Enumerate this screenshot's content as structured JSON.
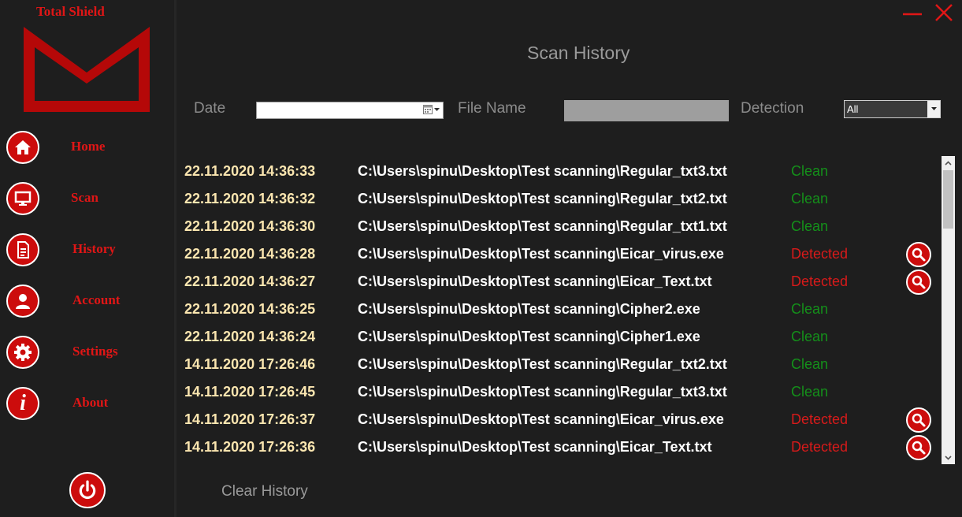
{
  "app": {
    "title": "Total Shield"
  },
  "nav": [
    {
      "label": "Home",
      "icon": "home-icon"
    },
    {
      "label": "Scan",
      "icon": "monitor-icon"
    },
    {
      "label": "History",
      "icon": "document-icon"
    },
    {
      "label": "Account",
      "icon": "user-icon"
    },
    {
      "label": "Settings",
      "icon": "gear-icon"
    },
    {
      "label": "About",
      "icon": "info-icon"
    }
  ],
  "page": {
    "title": "Scan History"
  },
  "filters": {
    "date_label": "Date",
    "date_value": "",
    "filename_label": "File Name",
    "filename_value": "",
    "detection_label": "Detection",
    "detection_value": "All"
  },
  "history": [
    {
      "date": "22.11.2020 14:36:33",
      "path": "C:\\Users\\spinu\\Desktop\\Test scanning\\Regular_txt3.txt",
      "status": "Clean"
    },
    {
      "date": "22.11.2020 14:36:32",
      "path": "C:\\Users\\spinu\\Desktop\\Test scanning\\Regular_txt2.txt",
      "status": "Clean"
    },
    {
      "date": "22.11.2020 14:36:30",
      "path": "C:\\Users\\spinu\\Desktop\\Test scanning\\Regular_txt1.txt",
      "status": "Clean"
    },
    {
      "date": "22.11.2020 14:36:28",
      "path": "C:\\Users\\spinu\\Desktop\\Test scanning\\Eicar_virus.exe",
      "status": "Detected"
    },
    {
      "date": "22.11.2020 14:36:27",
      "path": "C:\\Users\\spinu\\Desktop\\Test scanning\\Eicar_Text.txt",
      "status": "Detected"
    },
    {
      "date": "22.11.2020 14:36:25",
      "path": "C:\\Users\\spinu\\Desktop\\Test scanning\\Cipher2.exe",
      "status": "Clean"
    },
    {
      "date": "22.11.2020 14:36:24",
      "path": "C:\\Users\\spinu\\Desktop\\Test scanning\\Cipher1.exe",
      "status": "Clean"
    },
    {
      "date": "14.11.2020 17:26:46",
      "path": "C:\\Users\\spinu\\Desktop\\Test scanning\\Regular_txt2.txt",
      "status": "Clean"
    },
    {
      "date": "14.11.2020 17:26:45",
      "path": "C:\\Users\\spinu\\Desktop\\Test scanning\\Regular_txt3.txt",
      "status": "Clean"
    },
    {
      "date": "14.11.2020 17:26:37",
      "path": "C:\\Users\\spinu\\Desktop\\Test scanning\\Eicar_virus.exe",
      "status": "Detected"
    },
    {
      "date": "14.11.2020 17:26:36",
      "path": "C:\\Users\\spinu\\Desktop\\Test scanning\\Eicar_Text.txt",
      "status": "Detected"
    }
  ],
  "actions": {
    "clear_history": "Clear History"
  },
  "colors": {
    "accent": "#cc0c0c",
    "background": "#1e1e1e",
    "clean": "#14901a",
    "detected": "#d81a1a",
    "date_text": "#fbe6b0"
  }
}
